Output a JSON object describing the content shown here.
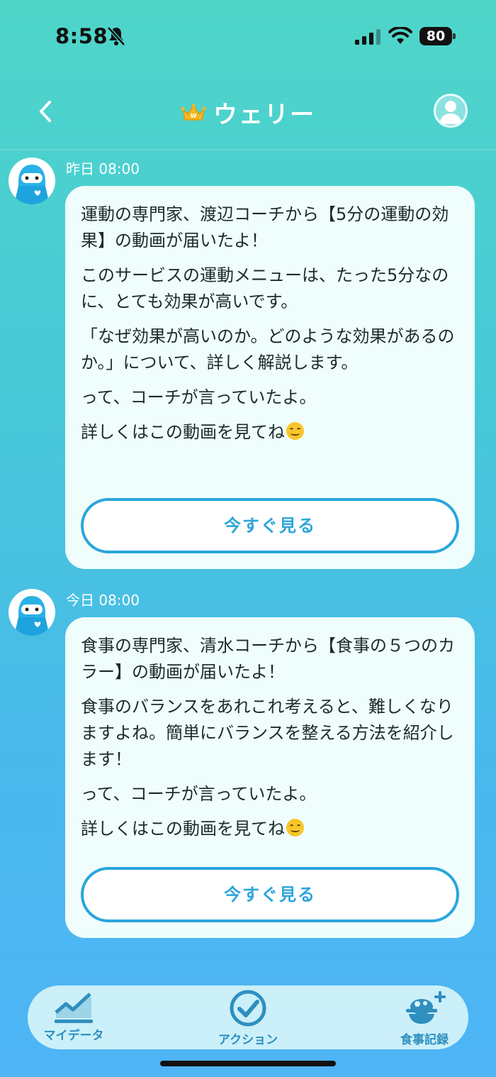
{
  "status_bar": {
    "time": "8:58",
    "battery": "80",
    "icons": [
      "bell-muted-icon",
      "signal-icon",
      "wifi-icon",
      "battery-icon"
    ]
  },
  "header": {
    "title": "ウェリー",
    "icons": [
      "back-icon",
      "crown-icon",
      "profile-icon"
    ]
  },
  "messages": [
    {
      "timestamp": "昨日 08:00",
      "paragraphs": [
        "運動の専門家、渡辺コーチから【5分の運動の効果】の動画が届いたよ！",
        "このサービスの運動メニューは、たった5分なのに、とても効果が高いです。",
        "「なぜ効果が高いのか。どのような効果があるのか。」について、詳しく解説します。",
        "って、コーチが言っていたよ。",
        "詳しくはこの動画を見てね"
      ],
      "button_label": "今すぐ見る"
    },
    {
      "timestamp": "今日 08:00",
      "paragraphs": [
        "食事の専門家、清水コーチから【食事の５つのカラー】の動画が届いたよ！",
        "食事のバランスをあれこれ考えると、難しくなりますよね。簡単にバランスを整える方法を紹介します！",
        "って、コーチが言っていたよ。",
        "詳しくはこの動画を見てね"
      ],
      "button_label": "今すぐ見る"
    }
  ],
  "bottom_nav": {
    "items": [
      {
        "label": "マイデータ",
        "icon": "chart-line-icon"
      },
      {
        "label": "アクション",
        "icon": "check-circle-icon"
      },
      {
        "label": "食事記録",
        "icon": "meal-bowl-add-icon"
      }
    ]
  },
  "colors": {
    "accent": "#2ea5da",
    "bubble": "#effdfc",
    "nav_bg": "#d6f5f8"
  }
}
